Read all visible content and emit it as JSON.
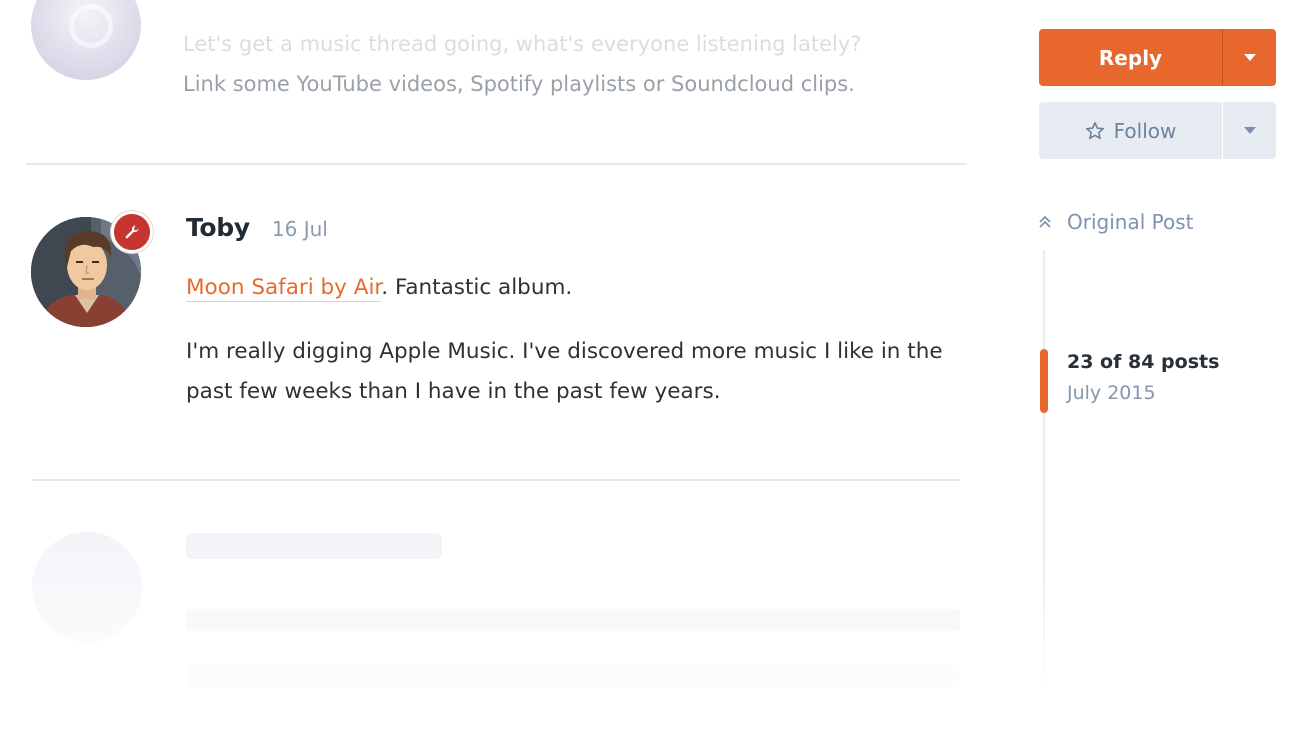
{
  "previous_post": {
    "text_line_1": "Let's get a music thread going, what's everyone listening lately?",
    "text_line_2": "Link some YouTube videos, Spotify playlists or Soundcloud clips."
  },
  "post": {
    "username": "Toby",
    "date": "16 Jul",
    "link_text": "Moon Safari by Air",
    "paragraph_1_rest": ". Fantastic album.",
    "paragraph_2_line_1": "I'm really digging Apple Music. I've discovered more music I like in the",
    "paragraph_2_line_2": "past few weeks than I have in the past few years.",
    "badge_icon": "wrench-icon"
  },
  "controls": {
    "reply_label": "Reply",
    "follow_label": "Follow",
    "reply_color": "#e8672c",
    "follow_bg": "#e7ecf3"
  },
  "scrubber": {
    "original_post_label": "Original Post",
    "position_label": "23 of 84 posts",
    "date_label": "July 2015",
    "current_post": 23,
    "total_posts": 84,
    "handle_color": "#e8672c"
  }
}
